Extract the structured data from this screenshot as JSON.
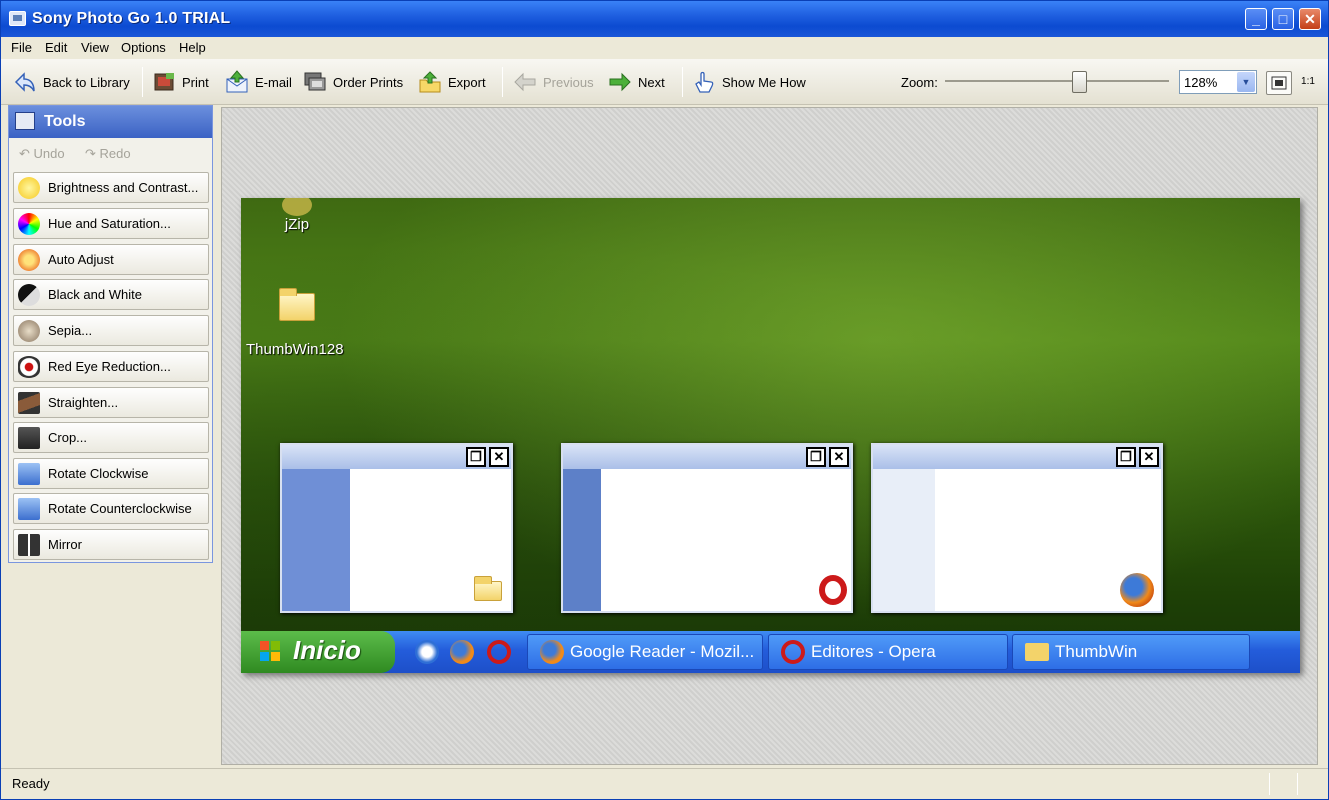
{
  "window": {
    "title": "Sony Photo Go 1.0 TRIAL"
  },
  "titlebar_buttons": {
    "minimize": "_",
    "maximize": "□",
    "close": "✕"
  },
  "menu": [
    "File",
    "Edit",
    "View",
    "Options",
    "Help"
  ],
  "toolbar": {
    "back": "Back to Library",
    "print": "Print",
    "email": "E-mail",
    "order_prints": "Order Prints",
    "export": "Export",
    "previous": "Previous",
    "next": "Next",
    "show_me_how": "Show Me How",
    "zoom_label": "Zoom:",
    "zoom_value": "128%",
    "zoom_level": 0.6,
    "actual_size": "1:1"
  },
  "tools": {
    "title": "Tools",
    "undo": "Undo",
    "redo": "Redo",
    "items": [
      "Brightness and Contrast...",
      "Hue and Saturation...",
      "Auto Adjust",
      "Black and White",
      "Sepia...",
      "Red Eye Reduction...",
      "Straighten...",
      "Crop...",
      "Rotate Clockwise",
      "Rotate Counterclockwise",
      "Mirror"
    ]
  },
  "photo": {
    "desktop_icons": [
      "jZip",
      "ThumbWin128"
    ],
    "start_label": "Inicio",
    "tasks": [
      "Google Reader - Mozil...",
      "Editores - Opera",
      "ThumbWin"
    ]
  },
  "status": {
    "text": "Ready"
  }
}
